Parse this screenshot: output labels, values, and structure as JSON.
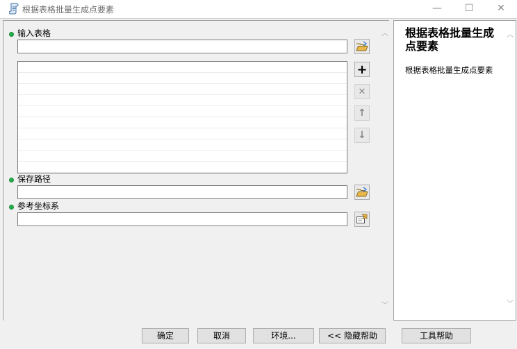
{
  "window": {
    "title": "根据表格批量生成点要素",
    "minimize_glyph": "—",
    "maximize_glyph": "☐",
    "close_glyph": "✕",
    "icon": "script-tool-icon"
  },
  "params": [
    {
      "label": "输入表格",
      "required": true,
      "type": "table-input"
    },
    {
      "label": "保存路径",
      "required": true,
      "type": "folder-input"
    },
    {
      "label": "参考坐标系",
      "required": true,
      "type": "spatial-reference"
    }
  ],
  "param_values": {
    "input_table": "",
    "save_path": "",
    "ref_coord": ""
  },
  "list_tools": {
    "add": "+",
    "remove": "✕",
    "up": "↑",
    "down": "↓"
  },
  "help": {
    "title": "根据表格批量生成点要素",
    "description": "根据表格批量生成点要素"
  },
  "buttons": {
    "ok": "确定",
    "cancel": "取消",
    "env": "环境...",
    "hide_help": "<< 隐藏帮助",
    "tool_help": "工具帮助"
  },
  "colors": {
    "required_dot": "#22b14c",
    "folder_icon": "#e8b84a"
  }
}
